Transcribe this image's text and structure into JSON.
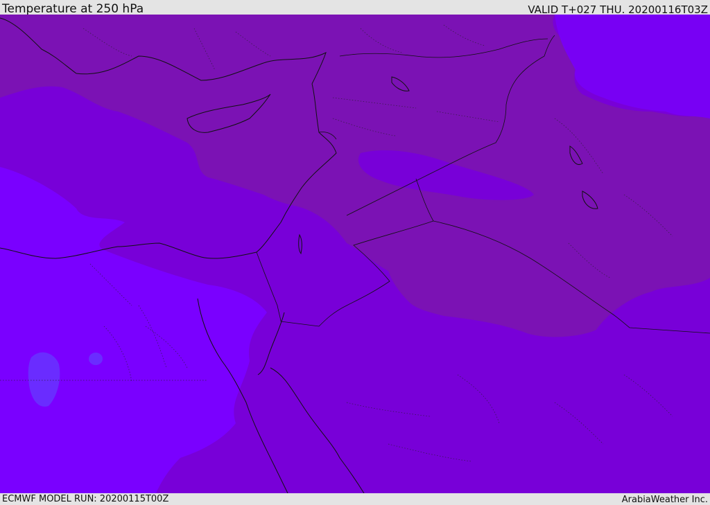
{
  "header": {
    "title": "Temperature at 250 hPa",
    "valid": "VALID T+027 THU. 20200116T03Z"
  },
  "footer": {
    "model_run": "ECMWF MODEL RUN: 20200115T00Z",
    "credit": "ArabiaWeather Inc."
  },
  "colors": {
    "band_warm": "#7b12b4",
    "band_mid": "#7800d8",
    "band_cool": "#7800f4",
    "band_cold": "#7a00ff",
    "band_coldest": "#6a2cff",
    "coastline": "#111111"
  }
}
